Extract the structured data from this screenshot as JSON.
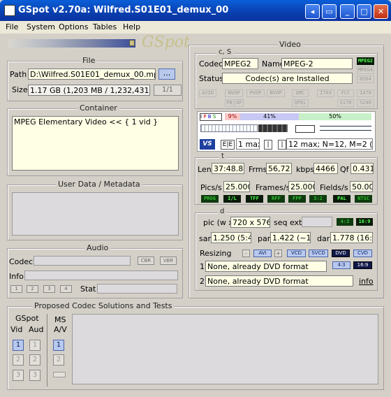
{
  "window": {
    "title": "GSpot v2.70a: Wilfred.S01E01_demux_00"
  },
  "menu": [
    "File",
    "System",
    "Options",
    "Tables",
    "Help"
  ],
  "logo": "GSpot",
  "file": {
    "legend": "File",
    "path_label": "Path",
    "path_value": "D:\\Wilfred.S01E01_demux_00.mpv",
    "browse_label": "...",
    "size_label": "Size",
    "size_value": "1.17 GB (1,203 MB / 1,232,431 KB",
    "part_label": "1/1"
  },
  "container": {
    "legend": "Container",
    "value": "MPEG Elementary Video << { 1 vid }"
  },
  "userdata": {
    "legend": "User Data / Metadata"
  },
  "audio": {
    "legend": "Audio",
    "codec_label": "Codec",
    "cbr": "CBR",
    "vbr": "VBR",
    "info_label": "Info",
    "stat_label": "Stat",
    "stream_buttons": [
      "1",
      "2",
      "3",
      "4"
    ]
  },
  "video": {
    "legend": "Video",
    "cs_label": "c, S",
    "codec_label": "Codec",
    "codec_value": "MPEG2",
    "name_label": "Name",
    "name_value": "MPEG-2",
    "status_label": "Status",
    "status_value": "Codec(s) are Installed",
    "right_tags": [
      "MPEG2",
      "MPEG4",
      "H264"
    ],
    "tags_row1": [
      "AVID",
      "NVOP",
      "PVOP",
      "BVOP",
      "GMC",
      "I703",
      "FCC",
      "I470"
    ],
    "tags_row2": [
      "PB",
      "DF",
      "QPEL",
      "S170",
      "S240"
    ],
    "frame_types": [
      "I",
      "P",
      "B",
      "S"
    ],
    "bar_pct1": "9%",
    "bar_pct2": "41%",
    "bar_pct3": "50%",
    "gop_max_label": "1 max",
    "gop_info": "12 max; N=12, M=2 (94%",
    "t_label": "t",
    "len_label": "Len",
    "len_value": "37:48.84",
    "frms_label": "Frms",
    "frms_value": "56,721",
    "kbps_label": "kbps",
    "kbps_value": "4466",
    "qf_label": "Qf",
    "qf_value": "0.431",
    "pics_label": "Pics/s",
    "pics_value": "25.000",
    "frames_label": "Frames/s",
    "frames_value": "25.000",
    "fields_label": "Fields/s",
    "fields_value": "50.00",
    "fmt_tags": [
      "PROG",
      "I/L",
      "TFF",
      "RFF",
      "FPP",
      "3:2",
      "PAL",
      "NTSC"
    ],
    "d_label": "d",
    "pic_label": "pic (w x",
    "pic_value": "720 x 576",
    "seq_label": "seq ext",
    "ar_tags": [
      "4:3",
      "16:9"
    ],
    "sar_label": "sar",
    "sar_value": "1.250 (5:4)",
    "par_label": "par",
    "par_value": "1.422 (~10:",
    "dar_label": "dar",
    "dar_value": "1.778 (16:9)",
    "resizing_label": "Resizing",
    "resize_buttons": [
      "AVI",
      "VCD",
      "SVCD",
      "DVD",
      "CVD"
    ],
    "ar_tags2": [
      "4:3",
      "16:9"
    ],
    "resize1_num": "1",
    "resize1_value": "None, already DVD format",
    "resize2_num": "2",
    "resize2_value": "None, already DVD format",
    "info_link": "info"
  },
  "proposed": {
    "legend": "Proposed Codec Solutions and Tests",
    "gspot_label": "GSpot",
    "vid_label": "Vid",
    "aud_label": "Aud",
    "ms_label": "MS",
    "av_label": "A/V",
    "nums": [
      "1",
      "2",
      "3"
    ]
  }
}
